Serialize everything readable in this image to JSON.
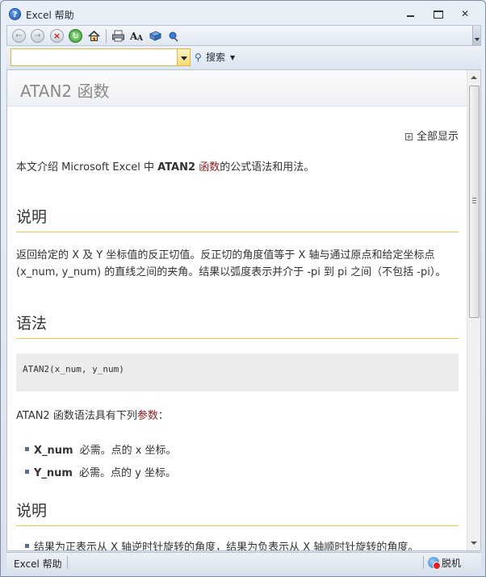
{
  "window": {
    "title": "Excel 帮助",
    "app_icon_glyph": "?"
  },
  "toolbar": {
    "icons": [
      "back-icon",
      "forward-icon",
      "stop-icon",
      "refresh-icon",
      "home-icon",
      "print-icon",
      "font-size-icon",
      "book-icon",
      "pin-icon"
    ]
  },
  "search": {
    "value": "",
    "button_label": "搜索"
  },
  "article": {
    "title": "ATAN2 函数",
    "show_all": "全部显示",
    "intro_pre": "本文介绍 Microsoft Excel 中 ",
    "intro_bold": "ATAN2",
    "intro_space": " ",
    "intro_link": "函数",
    "intro_post": "的公式语法和用法。",
    "section1_title": "说明",
    "section1_text": "返回给定的 X 及 Y 坐标值的反正切值。反正切的角度值等于 X 轴与通过原点和给定坐标点 (x_num, y_num) 的直线之间的夹角。结果以弧度表示并介于 -pi 到 pi 之间（不包括 -pi）。",
    "section2_title": "语法",
    "syntax": "ATAN2(x_num, y_num)",
    "params_intro_pre": "ATAN2 函数语法具有下列",
    "params_intro_link": "参数",
    "params_intro_post": "：",
    "params": [
      {
        "name": "X_num",
        "desc": "必需。点的 x 坐标。"
      },
      {
        "name": "Y_num",
        "desc": "必需。点的 y 坐标。"
      }
    ],
    "section3_title": "说明",
    "notes": [
      "结果为正表示从 X 轴逆时针旋转的角度，结果为负表示从 X 轴顺时针旋转的角度。"
    ]
  },
  "statusbar": {
    "left": "Excel 帮助",
    "right": "脱机"
  },
  "colors": {
    "link": "#8b1c1c",
    "heading_rule": "#f0c24e",
    "search_border": "#e0b445"
  }
}
